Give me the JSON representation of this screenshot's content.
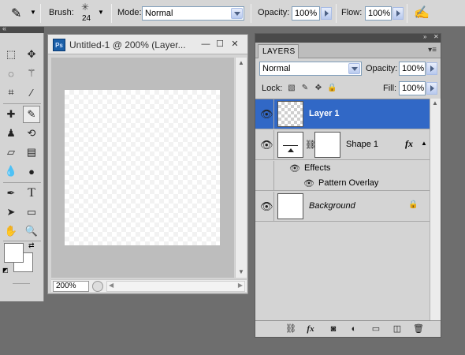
{
  "options_bar": {
    "brush_label": "Brush:",
    "brush_size": "24",
    "mode_label": "Mode:",
    "mode_value": "Normal",
    "opacity_label": "Opacity:",
    "opacity_value": "100%",
    "flow_label": "Flow:",
    "flow_value": "100%"
  },
  "tools_panel": {
    "tools": [
      "marquee-tool",
      "move-tool",
      "lasso-tool",
      "magic-wand-tool",
      "crop-tool",
      "eyedropper-tool",
      "healing-brush-tool",
      "brush-tool",
      "clone-stamp-tool",
      "history-brush-tool",
      "eraser-tool",
      "gradient-tool",
      "blur-tool",
      "dodge-tool",
      "pen-tool",
      "type-tool",
      "path-selection-tool",
      "shape-tool",
      "hand-tool",
      "zoom-tool"
    ],
    "selected_tool": "brush-tool",
    "foreground_color": "#ffffff",
    "background_color": "#ffffff"
  },
  "document": {
    "title": "Untitled-1 @ 200% (Layer...",
    "app_badge": "Ps",
    "zoom": "200%"
  },
  "layers_panel": {
    "tab_label": "LAYERS",
    "blend_mode": "Normal",
    "opacity_label": "Opacity:",
    "opacity_value": "100%",
    "lock_label": "Lock:",
    "fill_label": "Fill:",
    "fill_value": "100%",
    "layers": [
      {
        "name": "Layer 1",
        "selected": true
      },
      {
        "name": "Shape 1",
        "fx_badge": "fx"
      },
      {
        "name": "Background",
        "italic": true,
        "locked": true
      }
    ],
    "effects": {
      "group_label": "Effects",
      "items": [
        "Pattern Overlay"
      ]
    },
    "footer_icons": [
      "link-icon",
      "fx-icon",
      "mask-icon",
      "adjustment-icon",
      "group-icon",
      "new-layer-icon",
      "trash-icon"
    ]
  },
  "colors": {
    "selection_accent": "#3168c6",
    "panel_bg": "#d4d4d4",
    "workspace_bg": "#6e6e6e"
  }
}
